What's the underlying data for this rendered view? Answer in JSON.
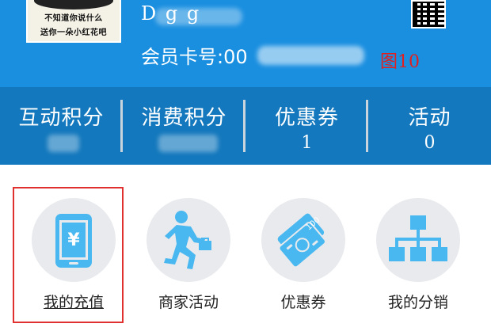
{
  "header": {
    "avatar_line1": "不知道你说什么",
    "avatar_line2": "送你一朵小红花吧",
    "username": "D    g  g",
    "card_label": "会员卡号:00",
    "figure_label": "图10",
    "bg_color": "#1a8fe0"
  },
  "stats": {
    "bg_color": "#1378bd",
    "items": [
      {
        "label": "互动积分",
        "value": ""
      },
      {
        "label": "消费积分",
        "value": ""
      },
      {
        "label": "优惠券",
        "value": "1"
      },
      {
        "label": "活动",
        "value": "0"
      }
    ]
  },
  "menu": {
    "icon_color": "#4ab8f0",
    "highlight_color": "#e03030",
    "items": [
      {
        "label": "我的充值",
        "icon": "phone-yen-icon"
      },
      {
        "label": "商家活动",
        "icon": "running-man-icon"
      },
      {
        "label": "优惠券",
        "icon": "coupon-ticket-icon"
      },
      {
        "label": "我的分销",
        "icon": "org-chart-icon"
      }
    ]
  }
}
